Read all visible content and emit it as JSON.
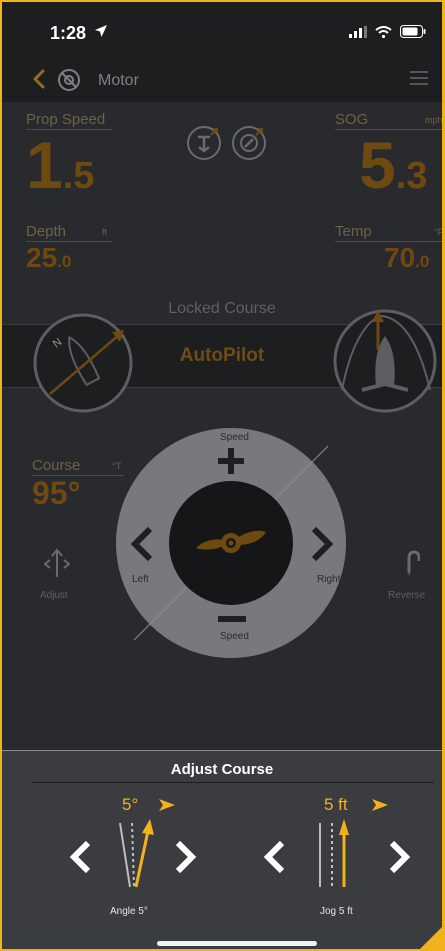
{
  "status": {
    "time": "1:28"
  },
  "nav": {
    "title": "Motor"
  },
  "gauges": {
    "prop_speed": {
      "label": "Prop Speed",
      "int": "1",
      "dec": ".5"
    },
    "sog": {
      "label": "SOG",
      "unit": "mph",
      "int": "5",
      "dec": ".3"
    },
    "depth": {
      "label": "Depth",
      "unit": "ft",
      "int": "25",
      "dec": ".0"
    },
    "temp": {
      "label": "Temp",
      "unit": "°F",
      "int": "70",
      "dec": ".0"
    }
  },
  "locked_course": "Locked Course",
  "autopilot": "AutoPilot",
  "course": {
    "label": "Course",
    "unit": "°T",
    "value": "95°"
  },
  "controls": {
    "adjust": "Adjust",
    "reverse": "Reverse",
    "speed_top": "Speed",
    "speed_bottom": "Speed",
    "left": "Left",
    "right": "Right"
  },
  "adjust_course": {
    "title": "Adjust Course",
    "angle_value": "5°",
    "angle_caption": "Angle 5°",
    "jog_value": "5 ft",
    "jog_caption": "Jog 5 ft"
  },
  "colors": {
    "accent": "#f2b21b",
    "dim_amber": "#6e4a10",
    "panel": "#3b3c40",
    "dash_bg": "#292a2d"
  },
  "icons": [
    "location-arrow-icon",
    "signal-icon",
    "wifi-icon",
    "battery-icon",
    "back-chevron-icon",
    "motor-icon",
    "menu-icon",
    "anchor-mode-icon",
    "compass-mode-icon",
    "heading-compass-icon",
    "autopilot-boat-icon",
    "adjust-arrows-icon",
    "reverse-icon",
    "propeller-icon"
  ]
}
